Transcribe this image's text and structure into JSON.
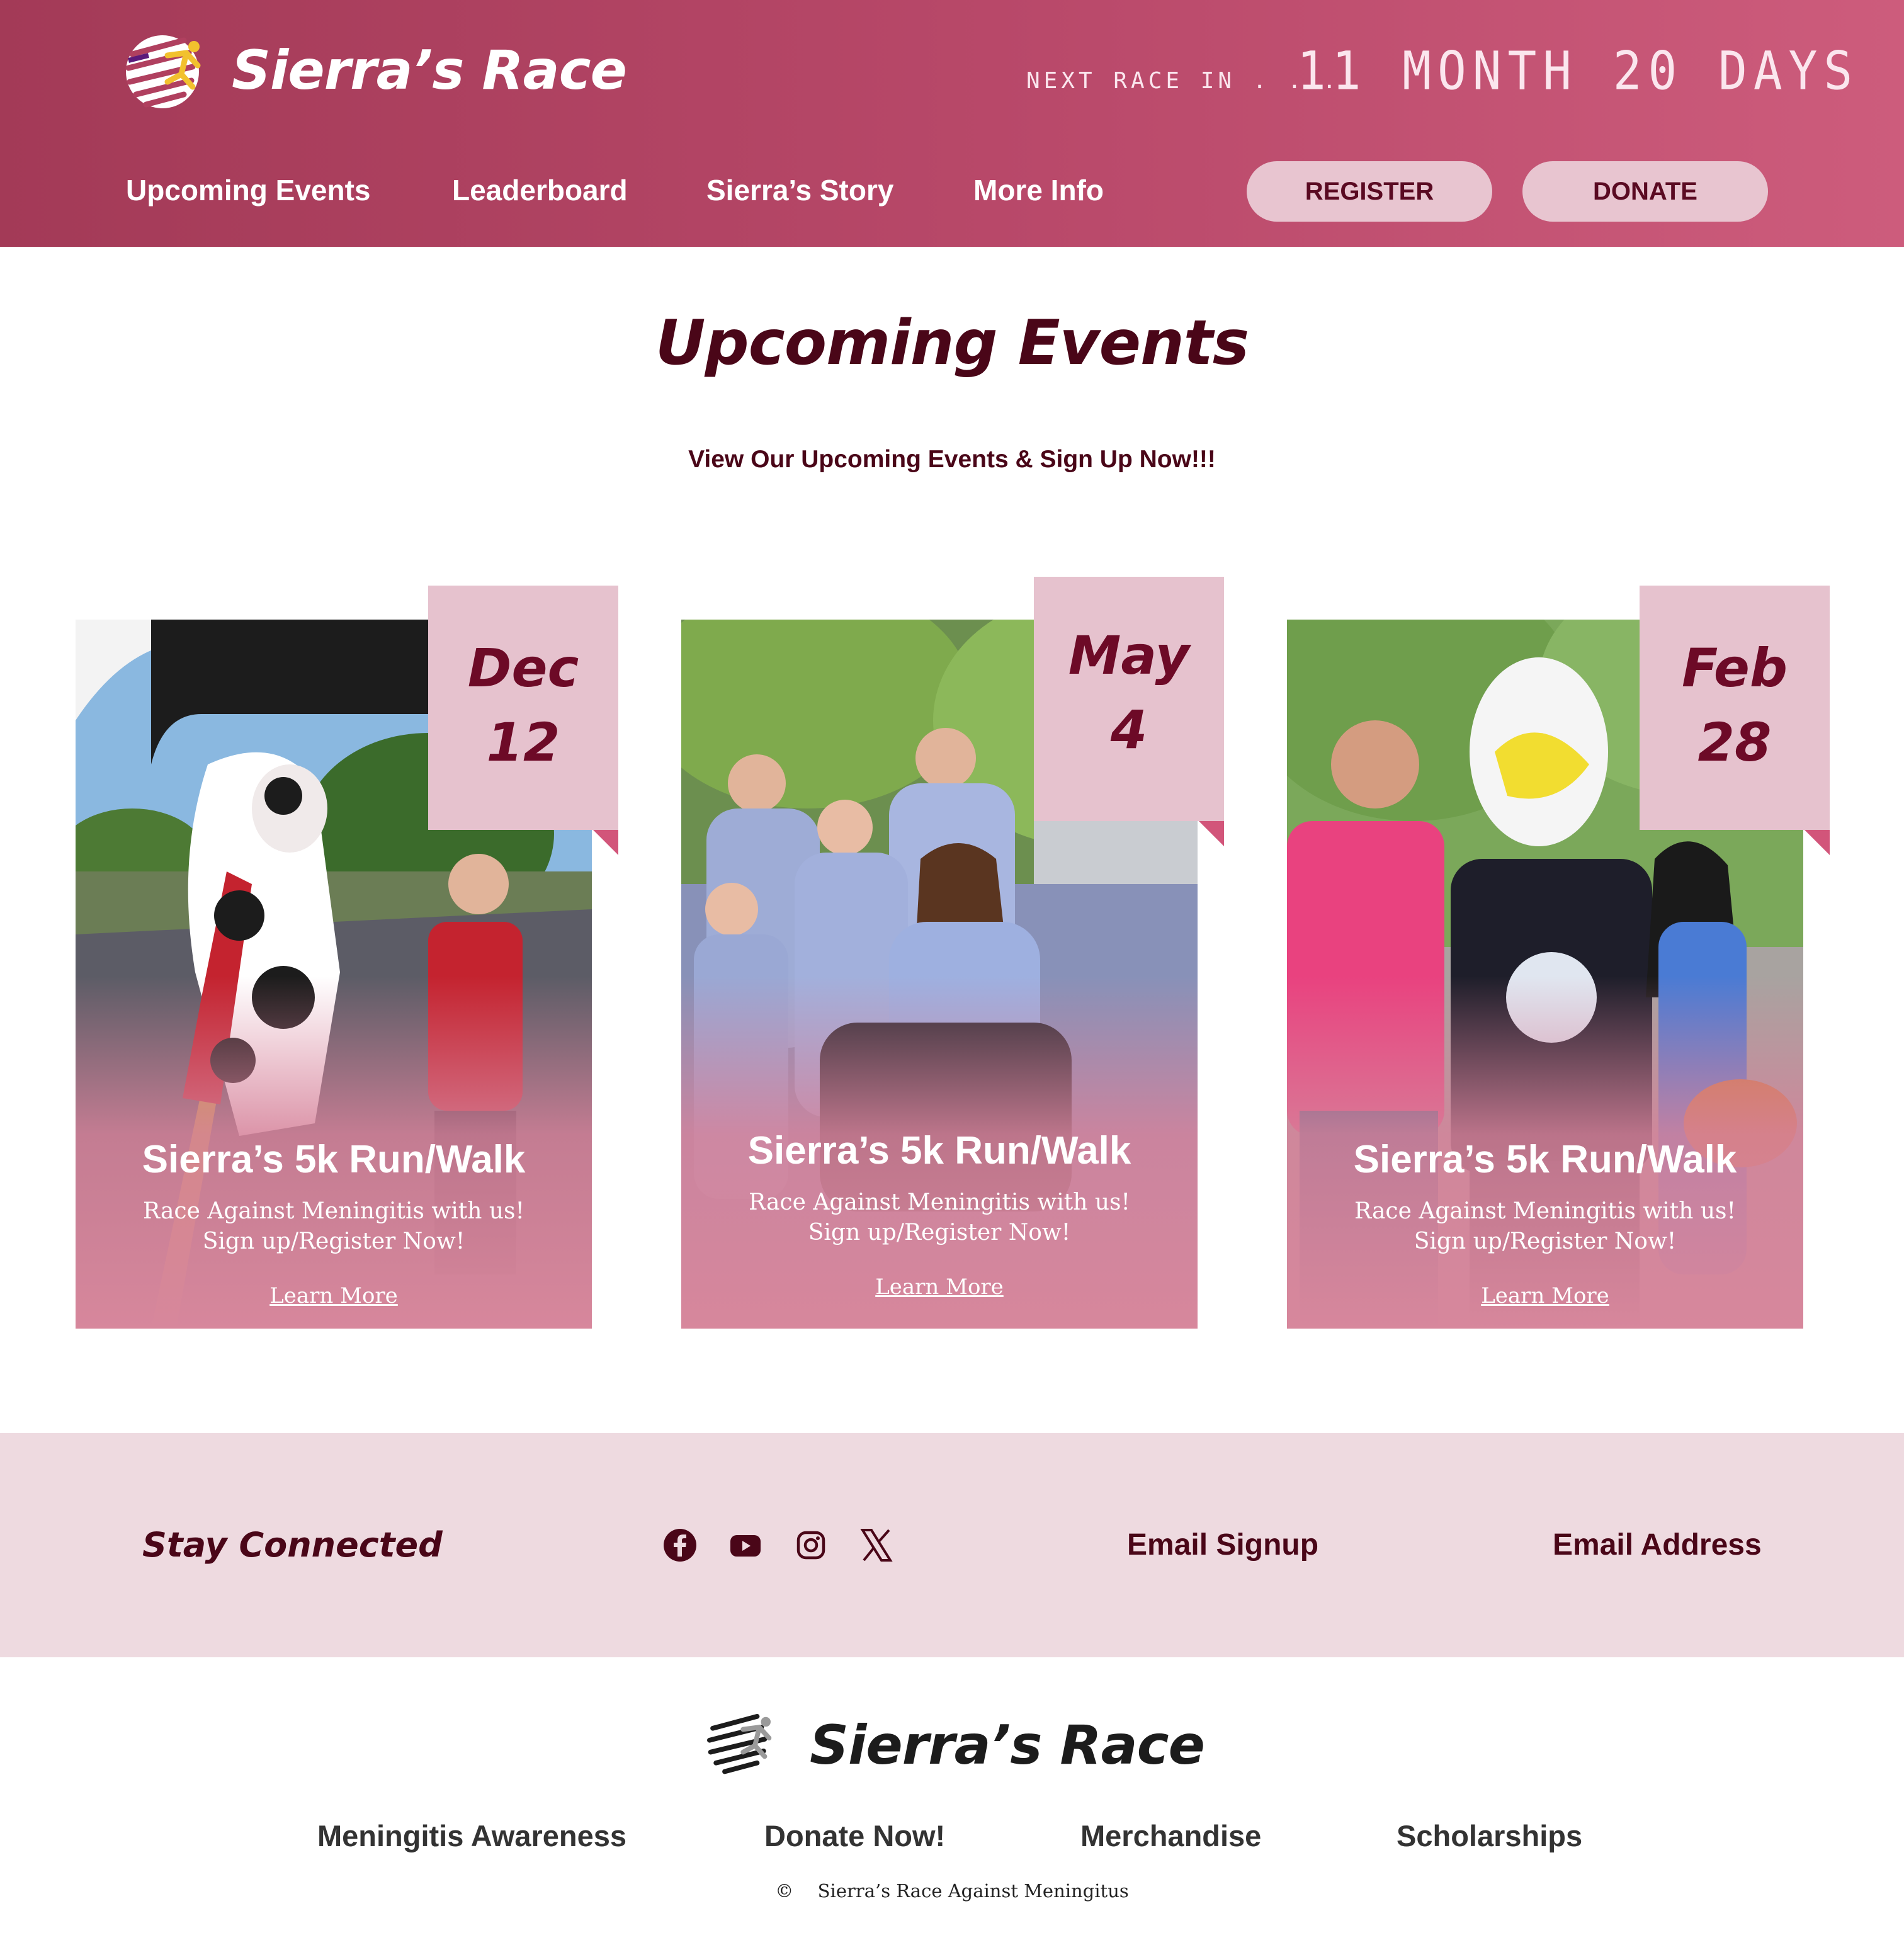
{
  "brand": {
    "name": "Sierra’s Race"
  },
  "countdown": {
    "label": "NEXT RACE IN . . .",
    "value": "11 MONTH 20 DAYS"
  },
  "nav": {
    "links": [
      "Upcoming Events",
      "Leaderboard",
      "Sierra’s Story",
      "More Info"
    ],
    "register_label": "REGISTER",
    "donate_label": "DONATE"
  },
  "main": {
    "title": "Upcoming Events",
    "subtitle": "View Our Upcoming Events & Sign Up Now!!!"
  },
  "events": [
    {
      "month": "Dec",
      "day": "12",
      "title": "Sierra’s 5k Run/Walk",
      "desc_line1": "Race Against Meningitis with us!",
      "desc_line2": "Sign up/Register Now!",
      "link": "Learn More"
    },
    {
      "month": "May",
      "day": "4",
      "title": "Sierra’s 5k Run/Walk",
      "desc_line1": "Race Against Meningitis with us!",
      "desc_line2": "Sign up/Register Now!",
      "link": "Learn More"
    },
    {
      "month": "Feb",
      "day": "28",
      "title": "Sierra’s 5k Run/Walk",
      "desc_line1": "Race Against Meningitis with us!",
      "desc_line2": "Sign up/Register Now!",
      "link": "Learn More"
    }
  ],
  "connected": {
    "title": "Stay Connected",
    "social_icons": [
      "facebook-icon",
      "youtube-icon",
      "instagram-icon",
      "x-icon"
    ],
    "email_signup": "Email Signup",
    "email_address": "Email Address"
  },
  "footer": {
    "brand": "Sierra’s Race",
    "links": [
      "Meningitis Awareness",
      "Donate Now!",
      "Merchandise",
      "Scholarships"
    ],
    "copyright_symbol": "©",
    "copyright_text": "Sierra’s Race Against Meningitus"
  },
  "colors": {
    "header_start": "#a33a57",
    "header_end": "#cd5c7c",
    "accent_dark": "#4a0618",
    "pill_bg": "#e8c5d0",
    "date_tab_bg": "#e6c2ce",
    "connected_bg": "#eedae0"
  }
}
